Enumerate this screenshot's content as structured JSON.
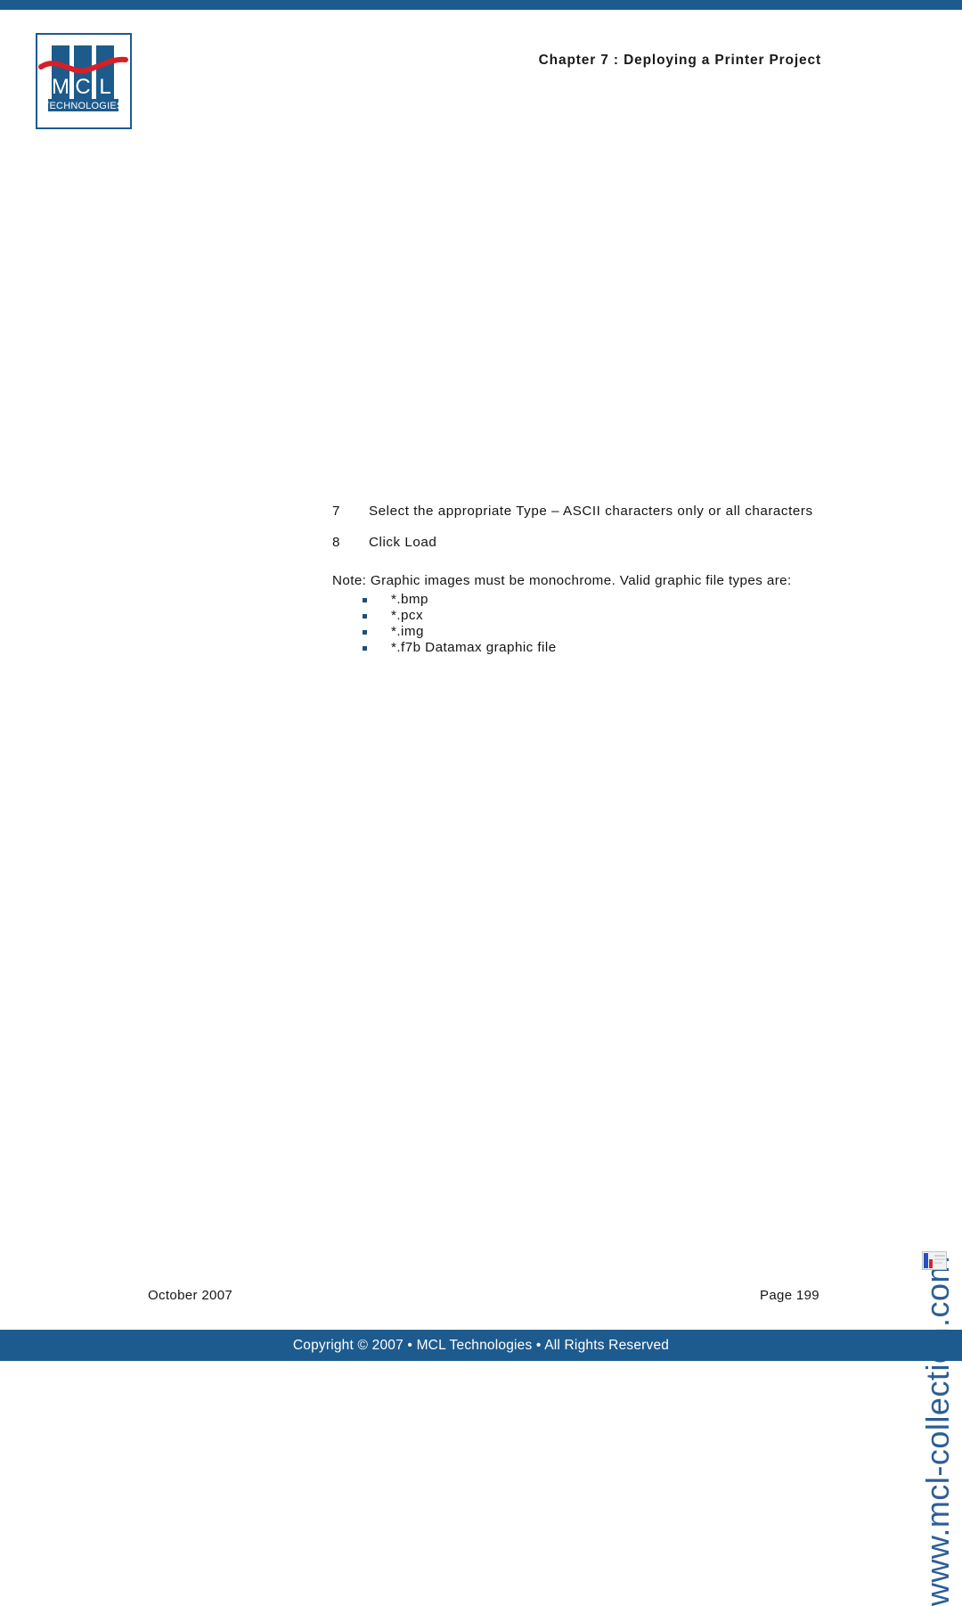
{
  "page": {
    "header_text": "Chapter 7 : Deploying a Printer Project",
    "accent_color": "#1d5b8e",
    "watermark_color": "#2c5e96",
    "bullet_color": "#1f4f77"
  },
  "logo": {
    "name": "MCL Technologies",
    "letters": [
      "M",
      "C",
      "L"
    ],
    "subtitle": "TECHNOLOGIES",
    "bar_color": "#1c5b8c",
    "wave_color": "#d71f28",
    "border_color": "#1d5b8e"
  },
  "body": {
    "steps": [
      {
        "number": "7",
        "text": "Select the appropriate Type – ASCII characters only or all characters"
      },
      {
        "number": "8",
        "text": "Click Load"
      }
    ],
    "note": "Note: Graphic images must be monochrome. Valid graphic file types are:",
    "file_types": [
      "*.bmp",
      "*.pcx",
      "*.img",
      "*.f7b Datamax graphic file"
    ]
  },
  "watermark": {
    "url": "www.mcl-collection.com"
  },
  "footer": {
    "date": "October 2007",
    "page": "Page  199",
    "copyright": "Copyright © 2007 • MCL Technologies • All Rights Reserved"
  }
}
